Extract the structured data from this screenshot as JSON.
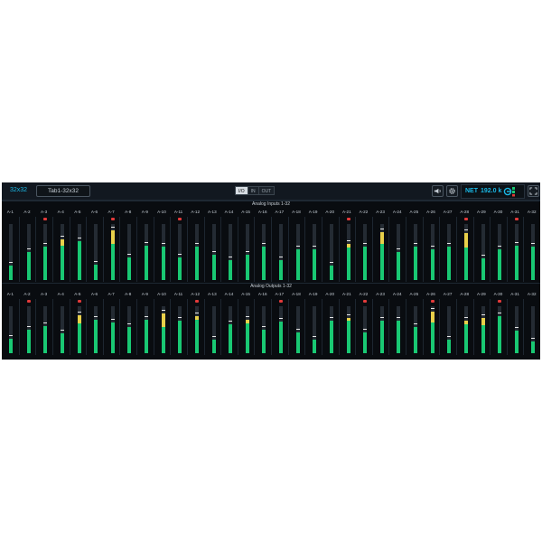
{
  "app": {
    "title": "32x32",
    "tab_label": "Tab1-32x32",
    "view_buttons": [
      "I/O",
      "IN",
      "OUT"
    ],
    "active_view": "I/O",
    "speaker_icon": "speaker-icon",
    "settings_icon": "gear-icon",
    "network_label": "NET",
    "sample_rate": "192.0 k",
    "sync_icon": "sync-status-icon",
    "fullscreen_icon": "fullscreen-icon"
  },
  "colors": {
    "accent": "#1ab8e6",
    "meter_green": "#19c873",
    "meter_yellow": "#e8d04a",
    "clip_red": "#e23a3a",
    "background": "#090c10"
  },
  "sections": [
    {
      "title": "Analog Inputs 1-32",
      "channels": [
        "A-1",
        "A-2",
        "A-3",
        "A-4",
        "A-5",
        "A-6",
        "A-7",
        "A-8",
        "A-9",
        "A-10",
        "A-11",
        "A-12",
        "A-13",
        "A-14",
        "A-15",
        "A-16",
        "A-17",
        "A-18",
        "A-19",
        "A-20",
        "A-21",
        "A-22",
        "A-23",
        "A-24",
        "A-25",
        "A-26",
        "A-27",
        "A-28",
        "A-29",
        "A-30",
        "A-31",
        "A-32"
      ],
      "levels": [
        0.25,
        0.5,
        0.6,
        0.72,
        0.7,
        0.28,
        0.88,
        0.4,
        0.62,
        0.6,
        0.4,
        0.6,
        0.45,
        0.35,
        0.45,
        0.6,
        0.35,
        0.55,
        0.55,
        0.26,
        0.65,
        0.6,
        0.86,
        0.5,
        0.6,
        0.55,
        0.6,
        0.84,
        0.38,
        0.55,
        0.62,
        0.6
      ],
      "warn": [
        0,
        0,
        0,
        0.16,
        0,
        0,
        0.28,
        0,
        0,
        0,
        0,
        0,
        0,
        0,
        0,
        0,
        0,
        0,
        0,
        0,
        0.1,
        0,
        0.24,
        0,
        0,
        0,
        0,
        0.3,
        0,
        0,
        0,
        0
      ],
      "clip": [
        false,
        false,
        true,
        false,
        false,
        false,
        true,
        false,
        false,
        false,
        true,
        false,
        false,
        false,
        false,
        false,
        false,
        false,
        false,
        false,
        true,
        false,
        false,
        false,
        false,
        false,
        false,
        true,
        false,
        false,
        true,
        false
      ]
    },
    {
      "title": "Analog Outputs 1-32",
      "channels": [
        "A-1",
        "A-2",
        "A-3",
        "A-4",
        "A-5",
        "A-6",
        "A-7",
        "A-8",
        "A-9",
        "A-10",
        "A-11",
        "A-12",
        "A-13",
        "A-14",
        "A-15",
        "A-16",
        "A-17",
        "A-18",
        "A-19",
        "A-20",
        "A-21",
        "A-22",
        "A-23",
        "A-24",
        "A-25",
        "A-26",
        "A-27",
        "A-28",
        "A-29",
        "A-30",
        "A-31",
        "A-32"
      ],
      "levels": [
        0.3,
        0.5,
        0.58,
        0.42,
        0.8,
        0.72,
        0.65,
        0.55,
        0.72,
        0.85,
        0.7,
        0.78,
        0.28,
        0.62,
        0.72,
        0.5,
        0.68,
        0.45,
        0.28,
        0.7,
        0.75,
        0.45,
        0.7,
        0.7,
        0.55,
        0.88,
        0.28,
        0.7,
        0.75,
        0.78,
        0.48,
        0.25
      ],
      "warn": [
        0,
        0,
        0,
        0,
        0.22,
        0,
        0,
        0,
        0,
        0.35,
        0,
        0.1,
        0,
        0,
        0.1,
        0,
        0,
        0,
        0,
        0,
        0.08,
        0,
        0,
        0,
        0,
        0.25,
        0,
        0.1,
        0.2,
        0,
        0,
        0
      ],
      "clip": [
        false,
        true,
        false,
        false,
        true,
        false,
        false,
        false,
        false,
        false,
        false,
        true,
        false,
        false,
        false,
        false,
        true,
        false,
        false,
        false,
        false,
        true,
        false,
        false,
        false,
        true,
        false,
        false,
        false,
        true,
        false,
        false
      ]
    }
  ]
}
